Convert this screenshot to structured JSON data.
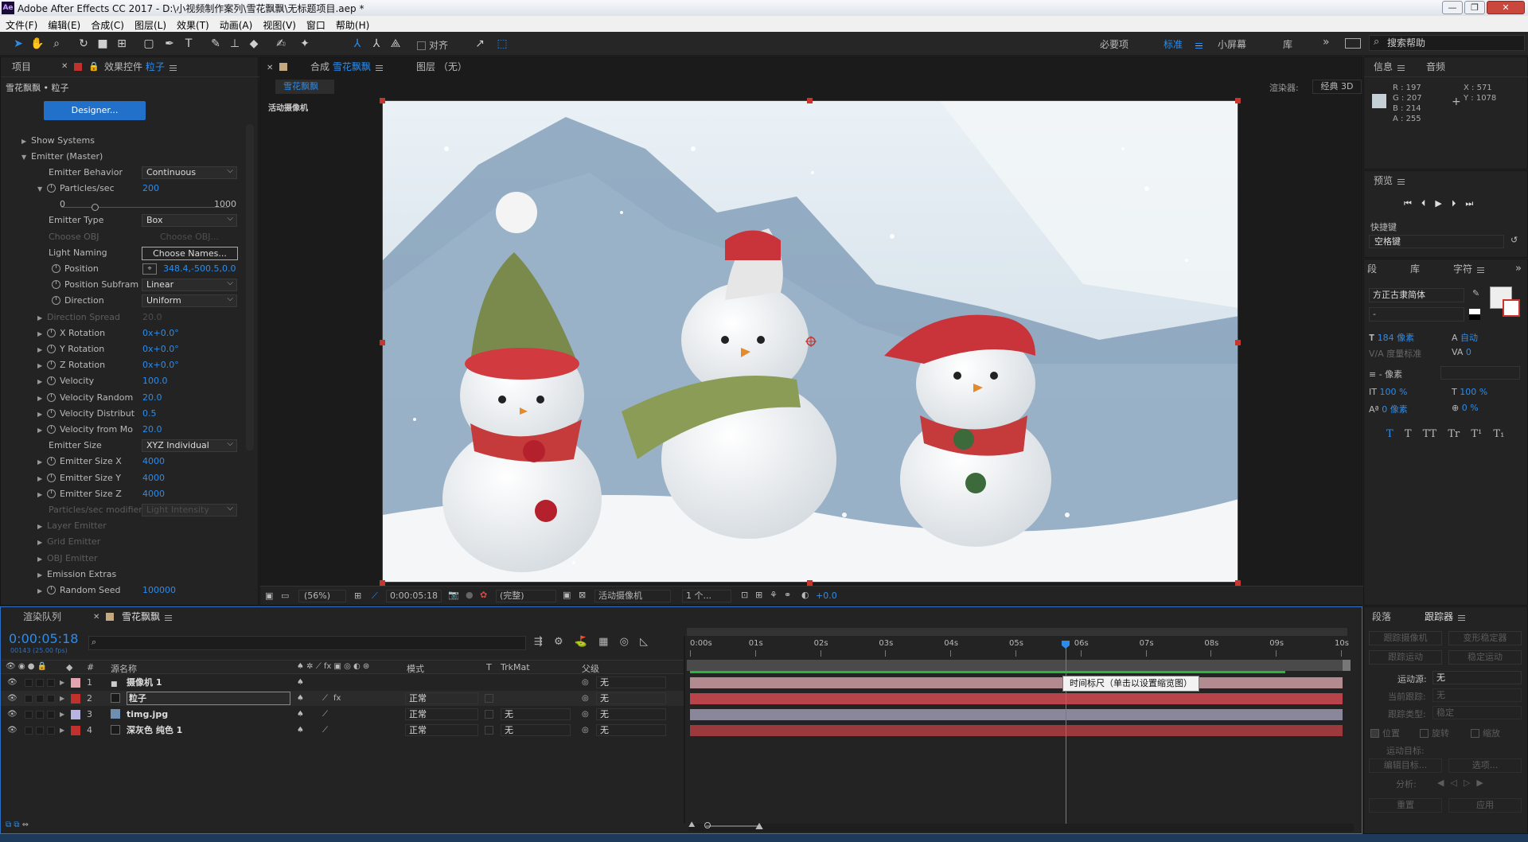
{
  "app": {
    "title": "Adobe After Effects CC 2017 - D:\\小视频制作案列\\雪花飘飘\\无标题项目.aep *",
    "logo": "Ae"
  },
  "window_controls": [
    "—",
    "❐",
    "✕"
  ],
  "menu": [
    "文件(F)",
    "编辑(E)",
    "合成(C)",
    "图层(L)",
    "效果(T)",
    "动画(A)",
    "视图(V)",
    "窗口",
    "帮助(H)"
  ],
  "toolbar": {
    "snap_label": "对齐",
    "workspaces": [
      "必要项",
      "标准",
      "小屏幕",
      "库"
    ],
    "active_workspace": "标准",
    "search_placeholder": "搜索帮助",
    "more": "»"
  },
  "left_panel": {
    "tab_project": "项目",
    "tab_effects": "效果控件",
    "tab_effects_target": "粒子",
    "header": "雪花飘飘 • 粒子",
    "designer_button": "Designer...",
    "rows": [
      {
        "type": "group",
        "label": "Show Systems",
        "open": false
      },
      {
        "type": "group",
        "label": "Emitter (Master)",
        "open": true
      },
      {
        "type": "dropdown",
        "label": "Emitter Behavior",
        "value": "Continuous"
      },
      {
        "type": "param",
        "label": "Particles/sec",
        "value": "200",
        "open": true,
        "stopwatch": true
      },
      {
        "type": "slider",
        "min": "0",
        "max": "1000",
        "pos": 0.2
      },
      {
        "type": "dropdown",
        "label": "Emitter Type",
        "value": "Box"
      },
      {
        "type": "dim",
        "label": "Choose OBJ",
        "value": "Choose OBJ..."
      },
      {
        "type": "button",
        "label": "Light Naming",
        "value": "Choose Names..."
      },
      {
        "type": "point",
        "label": "Position",
        "value": "348.4,-500.5,0.0",
        "stopwatch": true
      },
      {
        "type": "dropdown",
        "label": "Position Subfram",
        "value": "Linear",
        "stopwatch": true
      },
      {
        "type": "dropdown",
        "label": "Direction",
        "value": "Uniform",
        "stopwatch": true
      },
      {
        "type": "dimparam",
        "label": "Direction Spread",
        "value": "20.0"
      },
      {
        "type": "param",
        "label": "X Rotation",
        "value": "0x+0.0°",
        "stopwatch": true
      },
      {
        "type": "param",
        "label": "Y Rotation",
        "value": "0x+0.0°",
        "stopwatch": true
      },
      {
        "type": "param",
        "label": "Z Rotation",
        "value": "0x+0.0°",
        "stopwatch": true
      },
      {
        "type": "param",
        "label": "Velocity",
        "value": "100.0",
        "stopwatch": true
      },
      {
        "type": "param",
        "label": "Velocity Random",
        "value": "20.0",
        "stopwatch": true
      },
      {
        "type": "param",
        "label": "Velocity Distribut",
        "value": "0.5",
        "stopwatch": true
      },
      {
        "type": "param",
        "label": "Velocity from Mo",
        "value": "20.0",
        "stopwatch": true
      },
      {
        "type": "dropdown",
        "label": "Emitter Size",
        "value": "XYZ Individual"
      },
      {
        "type": "param",
        "label": "Emitter Size X",
        "value": "4000",
        "stopwatch": true
      },
      {
        "type": "param",
        "label": "Emitter Size Y",
        "value": "4000",
        "stopwatch": true
      },
      {
        "type": "param",
        "label": "Emitter Size Z",
        "value": "4000",
        "stopwatch": true
      },
      {
        "type": "dimdd",
        "label": "Particles/sec modifier",
        "value": "Light Intensity"
      },
      {
        "type": "dimgroup",
        "label": "Layer Emitter"
      },
      {
        "type": "dimgroup",
        "label": "Grid Emitter"
      },
      {
        "type": "dimgroup",
        "label": "OBJ Emitter"
      },
      {
        "type": "group",
        "label": "Emission Extras",
        "open": false
      },
      {
        "type": "param",
        "label": "Random Seed",
        "value": "100000",
        "stopwatch": true
      }
    ]
  },
  "comp_panel": {
    "tab_label": "合成",
    "tab_name": "雪花飘飘",
    "layer_tab": "图层 （无）",
    "comp_chip": "雪花飘飘",
    "renderer_label": "渲染器:",
    "renderer_value": "经典 3D",
    "camera_label": "活动摄像机",
    "footer": {
      "zoom": "(56%)",
      "timecode": "0:00:05:18",
      "quality": "(完整)",
      "camera": "活动摄像机",
      "views": "1 个...",
      "exposure": "+0.0"
    }
  },
  "info_panel": {
    "tab_info": "信息",
    "tab_audio": "音频",
    "r": "R : 197",
    "g": "G : 207",
    "b": "B : 214",
    "a": "A : 255",
    "x": "X : 571",
    "y": "Y : 1078",
    "swatch": "#c5cfd6"
  },
  "preview_panel": {
    "title": "预览",
    "shortcut_label": "快捷键",
    "shortcut_value": "空格键"
  },
  "char_panel": {
    "tabs": [
      "段",
      "库",
      "字符"
    ],
    "active": "字符",
    "font": "方正古隶简体",
    "style": "-",
    "size": "184 像素",
    "leading": "自动",
    "kerning": "度量标准",
    "tracking": "0",
    "stroke": "- 像素",
    "vscale": "100 %",
    "hscale": "100 %",
    "baseline": "0 像素",
    "tsume": "0 %",
    "styles": [
      "T",
      "T",
      "TT",
      "Tr",
      "T¹",
      "T₁"
    ]
  },
  "tracker_panel": {
    "tabs": [
      "段落",
      "跟踪器"
    ],
    "active": "跟踪器",
    "btn_track_cam": "跟踪摄像机",
    "btn_warp": "变形稳定器",
    "btn_track_motion": "跟踪运动",
    "btn_stabilize": "稳定运动",
    "source_label": "运动源:",
    "source_value": "无",
    "current_track": "当前跟踪:",
    "current_track_value": "无",
    "track_type": "跟踪类型:",
    "track_type_value": "稳定",
    "chk_pos": "位置",
    "chk_rot": "旋转",
    "chk_scale": "缩放",
    "target": "运动目标:",
    "edit_target": "编辑目标...",
    "options": "选项...",
    "analyze": "分析:",
    "reset": "重置",
    "apply": "应用"
  },
  "timeline": {
    "tab_render": "渲染队列",
    "tab_comp": "雪花飘飘",
    "timecode": "0:00:05:18",
    "fps": "00143 (25.00 fps)",
    "search_placeholder": "",
    "col_headers": {
      "num": "#",
      "name": "源名称",
      "mode": "模式",
      "t": "T",
      "trkmat": "TrkMat",
      "parent": "父级"
    },
    "ruler": [
      "0:00s",
      "01s",
      "02s",
      "03s",
      "04s",
      "05s",
      "06s",
      "07s",
      "08s",
      "09s",
      "10s"
    ],
    "playhead": 0.577,
    "tooltip": "时间标尺（单击以设置缩览图）",
    "layers": [
      {
        "num": "1",
        "name": "摄像机 1",
        "label_color": "#e3a4b2",
        "mode": "",
        "trkmat": "",
        "parent": "无",
        "bar": "#b48a91",
        "icon": "camera"
      },
      {
        "num": "2",
        "name": "粒子",
        "label_color": "#c0312e",
        "mode": "正常",
        "trkmat": "",
        "parent": "无",
        "bar": "#b9434a",
        "icon": "solid-dark",
        "selected": true
      },
      {
        "num": "3",
        "name": "timg.jpg",
        "label_color": "#b7b4e0",
        "mode": "正常",
        "trkmat": "无",
        "parent": "无",
        "bar": "#8a879b",
        "icon": "image"
      },
      {
        "num": "4",
        "name": "深灰色 纯色 1",
        "label_color": "#c0312e",
        "mode": "正常",
        "trkmat": "无",
        "parent": "无",
        "bar": "#9b393c",
        "icon": "solid-dark"
      }
    ]
  },
  "colors": {
    "accent": "#2d8ceb",
    "panel": "#232323",
    "handle": "#c8352c"
  }
}
